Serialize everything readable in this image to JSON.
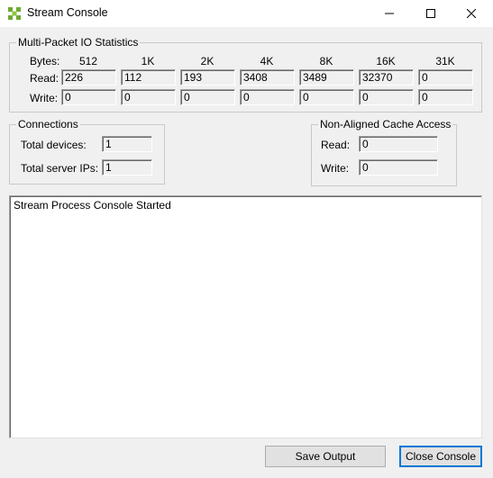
{
  "window": {
    "title": "Stream Console"
  },
  "io_stats": {
    "legend": "Multi-Packet IO Statistics",
    "bytes_label": "Bytes:",
    "read_label": "Read:",
    "write_label": "Write:",
    "columns": [
      "512",
      "1K",
      "2K",
      "4K",
      "8K",
      "16K",
      "31K"
    ],
    "read_values": [
      "226",
      "112",
      "193",
      "3408",
      "3489",
      "32370",
      "0"
    ],
    "write_values": [
      "0",
      "0",
      "0",
      "0",
      "0",
      "0",
      "0"
    ]
  },
  "connections": {
    "legend": "Connections",
    "total_devices_label": "Total devices:",
    "total_devices": "1",
    "total_server_ips_label": "Total server IPs:",
    "total_server_ips": "1"
  },
  "cache": {
    "legend": "Non-Aligned Cache Access",
    "read_label": "Read:",
    "read_value": "0",
    "write_label": "Write:",
    "write_value": "0"
  },
  "console": {
    "text": "Stream Process Console Started"
  },
  "buttons": {
    "save_output": "Save Output",
    "close_console": "Close Console"
  },
  "colors": {
    "background": "#f0f0f0",
    "focus_border": "#0078d7"
  }
}
